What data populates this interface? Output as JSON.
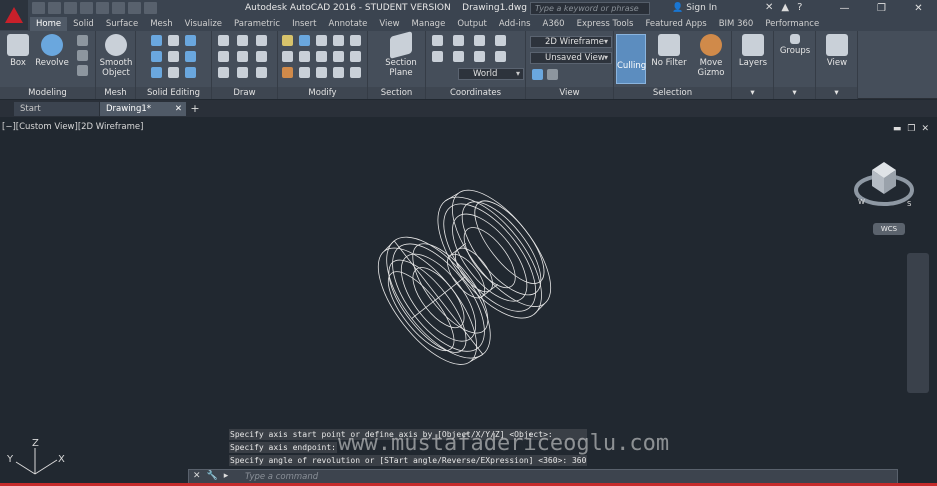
{
  "title": {
    "app": "Autodesk AutoCAD 2016 - STUDENT VERSION",
    "file": "Drawing1.dwg"
  },
  "search": {
    "placeholder": "Type a keyword or phrase"
  },
  "account": {
    "signin": "Sign In"
  },
  "ribbon_tabs": [
    "Home",
    "Solid",
    "Surface",
    "Mesh",
    "Visualize",
    "Parametric",
    "Insert",
    "Annotate",
    "View",
    "Manage",
    "Output",
    "Add-ins",
    "A360",
    "Express Tools",
    "Featured Apps",
    "BIM 360",
    "Performance"
  ],
  "active_tab": "Home",
  "panels": {
    "modeling": {
      "label": "Modeling",
      "box": "Box",
      "revolve": "Revolve",
      "smooth_object": "Smooth Object"
    },
    "mesh": {
      "label": "Mesh"
    },
    "solid_editing": {
      "label": "Solid Editing"
    },
    "draw": {
      "label": "Draw"
    },
    "modify": {
      "label": "Modify"
    },
    "section": {
      "label": "Section",
      "section_plane": "Section Plane"
    },
    "coordinates": {
      "label": "Coordinates",
      "ucs": "World"
    },
    "view": {
      "label": "View",
      "visual_style": "2D Wireframe",
      "named_view": "Unsaved View"
    },
    "selection": {
      "label": "Selection",
      "culling": "Culling",
      "no_filter": "No Filter",
      "move_gizmo": "Move Gizmo"
    },
    "layers": {
      "label": "Layers"
    },
    "groups": {
      "label": "Groups"
    },
    "view_panel": {
      "label": "View"
    }
  },
  "doc_tabs": [
    {
      "label": "Start"
    },
    {
      "label": "Drawing1*"
    }
  ],
  "viewport": {
    "label": "[−][Custom View][2D Wireframe]",
    "wcs": "WCS",
    "viewcube_dirs": {
      "w": "W",
      "s": "S"
    }
  },
  "command": {
    "history": [
      "Specify axis start point or define axis by [Object/X/Y/Z] <Object>:",
      "Specify axis endpoint:",
      "Specify angle of revolution or [STart angle/Reverse/EXpression] <360>: 360"
    ],
    "prompt_placeholder": "Type a command"
  },
  "watermark": "www.mustafadericeoglu.com",
  "ucs_icon": {
    "x": "X",
    "y": "Y",
    "z": "Z"
  }
}
